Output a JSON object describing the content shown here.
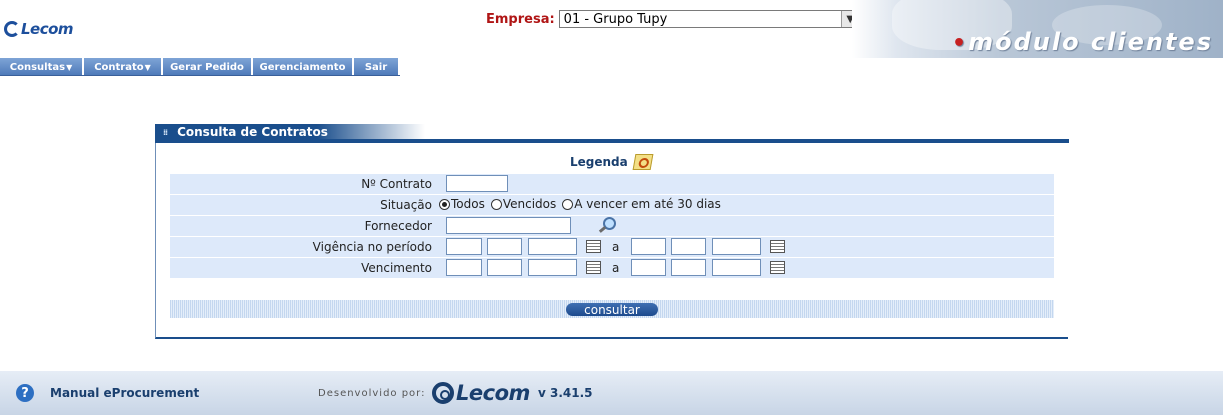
{
  "header": {
    "logo_text": "Lecom",
    "empresa_label": "Empresa:",
    "empresa_value": "01 - Grupo Tupy",
    "module_title": "módulo clientes"
  },
  "menu": [
    {
      "label": "Consultas",
      "has_dropdown": true
    },
    {
      "label": "Contrato",
      "has_dropdown": true
    },
    {
      "label": "Gerar Pedido",
      "has_dropdown": false
    },
    {
      "label": "Gerenciamento",
      "has_dropdown": false
    },
    {
      "label": "Sair",
      "has_dropdown": false
    }
  ],
  "panel": {
    "title": "Consulta de Contratos",
    "legenda": "Legenda",
    "fields": {
      "contrato": "Nº Contrato",
      "situacao": "Situação",
      "fornecedor": "Fornecedor",
      "vigencia": "Vigência no período",
      "vencimento": "Vencimento"
    },
    "situacao_options": [
      "Todos",
      "Vencidos",
      "A vencer em até 30 dias"
    ],
    "situacao_selected": "Todos",
    "range_separator": "a",
    "submit_label": "consultar"
  },
  "footer": {
    "manual": "Manual eProcurement",
    "developed_by": "Desenvolvido por:",
    "logo_text": "Lecom",
    "version": "v 3.41.5"
  },
  "colors": {
    "primary": "#1a4e8c",
    "row_bg": "#dde9fa",
    "empresa_label": "#b01515"
  }
}
